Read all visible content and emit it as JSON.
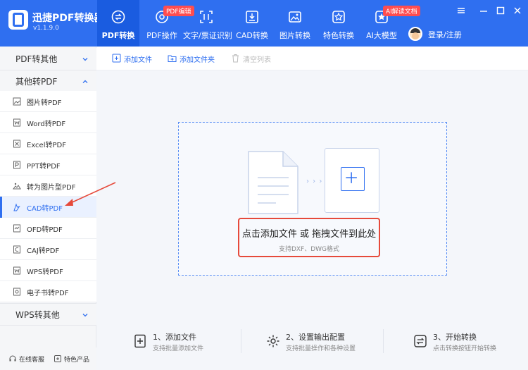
{
  "app": {
    "title": "迅捷PDF转换器",
    "version": "v1.1.9.0"
  },
  "nav": [
    {
      "label": "PDF转换",
      "icon": "convert-icon",
      "active": true
    },
    {
      "label": "PDF操作",
      "icon": "pdf-operate-icon",
      "badge": "PDF编辑"
    },
    {
      "label": "文字/票证识别",
      "icon": "scan-icon"
    },
    {
      "label": "CAD转换",
      "icon": "cad-icon"
    },
    {
      "label": "图片转换",
      "icon": "image-icon"
    },
    {
      "label": "特色转换",
      "icon": "star-icon"
    },
    {
      "label": "AI大模型",
      "icon": "ai-icon",
      "badge": "AI解读文档"
    }
  ],
  "login": {
    "label": "登录/注册"
  },
  "sidebar": {
    "group1": "PDF转其他",
    "group2": "其他转PDF",
    "group3": "WPS转其他",
    "items": [
      {
        "label": "图片转PDF",
        "icon": "image-file-icon"
      },
      {
        "label": "Word转PDF",
        "icon": "word-file-icon"
      },
      {
        "label": "Excel转PDF",
        "icon": "excel-file-icon"
      },
      {
        "label": "PPT转PDF",
        "icon": "ppt-file-icon"
      },
      {
        "label": "转为图片型PDF",
        "icon": "image-pdf-icon"
      },
      {
        "label": "CAD转PDF",
        "icon": "cad-file-icon",
        "active": true
      },
      {
        "label": "OFD转PDF",
        "icon": "ofd-file-icon"
      },
      {
        "label": "CAJ转PDF",
        "icon": "caj-file-icon"
      },
      {
        "label": "WPS转PDF",
        "icon": "wps-file-icon"
      },
      {
        "label": "电子书转PDF",
        "icon": "ebook-file-icon"
      }
    ],
    "bottom": {
      "service": "在线客服",
      "featured": "特色产品"
    }
  },
  "toolbar": {
    "add_file": "添加文件",
    "add_folder": "添加文件夹",
    "clear_list": "清空列表"
  },
  "dropzone": {
    "title": "点击添加文件 或 拖拽文件到此处",
    "subtitle": "支持DXF、DWG格式"
  },
  "steps": [
    {
      "title": "1、添加文件",
      "desc": "支持批量添加文件"
    },
    {
      "title": "2、设置输出配置",
      "desc": "支持批量操作和各种设置"
    },
    {
      "title": "3、开始转换",
      "desc": "点击转换按钮开始转换"
    }
  ],
  "colors": {
    "brand": "#2f6ff0",
    "highlight": "#e64a3b",
    "badge": "#ff4d4f"
  }
}
